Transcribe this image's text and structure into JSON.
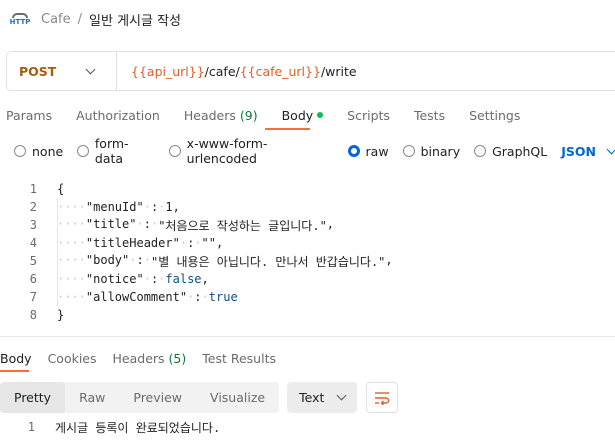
{
  "breadcrumb": {
    "icon_text": "HTTP",
    "parent": "Cafe",
    "separator": "/",
    "title": "일반 게시글 작성"
  },
  "request": {
    "method": "POST",
    "url_parts": [
      {
        "text": "{{api_url}}",
        "kind": "var"
      },
      {
        "text": "/cafe/",
        "kind": "plain"
      },
      {
        "text": "{{cafe_url}}",
        "kind": "var"
      },
      {
        "text": "/write",
        "kind": "plain"
      }
    ]
  },
  "request_tabs": [
    {
      "label": "Params"
    },
    {
      "label": "Authorization"
    },
    {
      "label": "Headers",
      "count": "(9)"
    },
    {
      "label": "Body",
      "active": true
    },
    {
      "label": "Scripts"
    },
    {
      "label": "Tests"
    },
    {
      "label": "Settings"
    }
  ],
  "body_types": [
    "none",
    "form-data",
    "x-www-form-urlencoded",
    "raw",
    "binary",
    "GraphQL"
  ],
  "body_type_selected": "raw",
  "body_language": "JSON",
  "code_lines": [
    {
      "n": "1",
      "text": "{"
    },
    {
      "n": "2",
      "key": "\"menuId\"",
      "value": "1",
      "vtype": "num",
      "comma": true
    },
    {
      "n": "3",
      "key": "\"title\"",
      "value": "\"처음으로 작성하는 글입니다.\"",
      "vtype": "str",
      "comma": true
    },
    {
      "n": "4",
      "key": "\"titleHeader\"",
      "value": "\"\"",
      "vtype": "str",
      "comma": true
    },
    {
      "n": "5",
      "key": "\"body\"",
      "value": "\"별 내용은 아닙니다. 만나서 반갑습니다.\"",
      "vtype": "str",
      "comma": true
    },
    {
      "n": "6",
      "key": "\"notice\"",
      "value": "false",
      "vtype": "bool",
      "comma": true
    },
    {
      "n": "7",
      "key": "\"allowComment\"",
      "value": "true",
      "vtype": "bool",
      "comma": false
    },
    {
      "n": "8",
      "text": "}"
    }
  ],
  "response_tabs": [
    {
      "label": "Body",
      "active": true
    },
    {
      "label": "Cookies"
    },
    {
      "label": "Headers",
      "count": "(5)"
    },
    {
      "label": "Test Results"
    }
  ],
  "view_modes": [
    "Pretty",
    "Raw",
    "Preview",
    "Visualize"
  ],
  "view_mode_selected": "Pretty",
  "response_format": "Text",
  "response_lines": [
    {
      "n": "1",
      "text": "게시글 등록이 완료되었습니다."
    }
  ],
  "colors": {
    "accent": "#ff6c37",
    "method": "#a55d0c",
    "variable": "#e05d2a",
    "selected": "#0265d2",
    "count": "#0d7a3c"
  }
}
